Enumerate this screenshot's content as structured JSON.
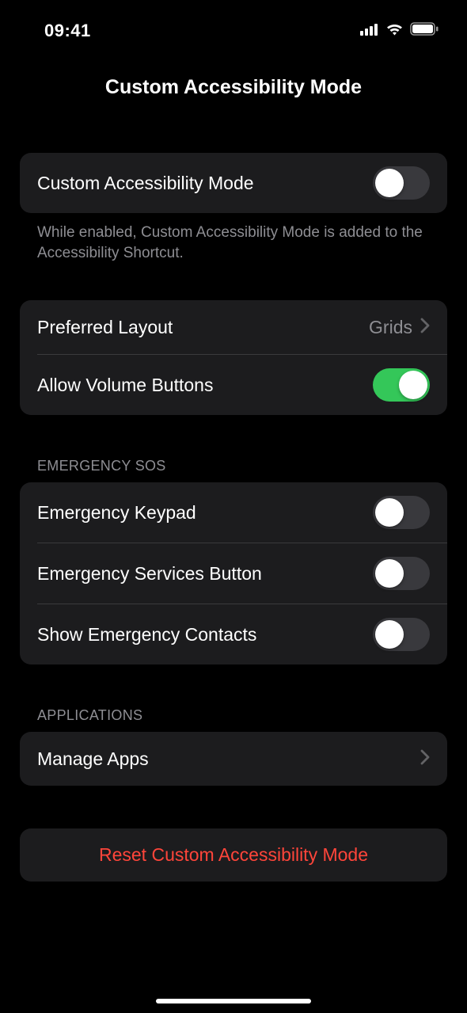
{
  "statusBar": {
    "time": "09:41"
  },
  "navBar": {
    "title": "Custom Accessibility Mode"
  },
  "section1": {
    "item": {
      "label": "Custom Accessibility Mode",
      "toggle": false
    },
    "footer": "While enabled, Custom Accessibility Mode is added to the Accessibility Shortcut."
  },
  "section2": {
    "layout": {
      "label": "Preferred Layout",
      "value": "Grids"
    },
    "volume": {
      "label": "Allow Volume Buttons",
      "toggle": true
    }
  },
  "section3": {
    "header": "EMERGENCY SOS",
    "keypad": {
      "label": "Emergency Keypad",
      "toggle": false
    },
    "services": {
      "label": "Emergency Services Button",
      "toggle": false
    },
    "contacts": {
      "label": "Show Emergency Contacts",
      "toggle": false
    }
  },
  "section4": {
    "header": "APPLICATIONS",
    "manage": {
      "label": "Manage Apps"
    }
  },
  "reset": {
    "label": "Reset Custom Accessibility Mode"
  }
}
